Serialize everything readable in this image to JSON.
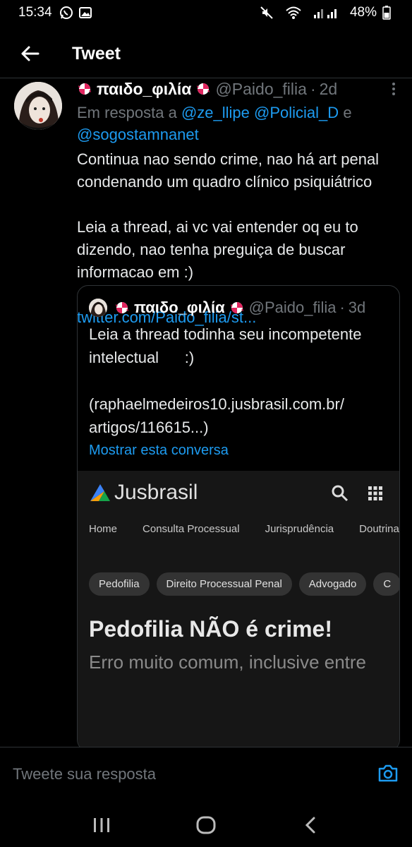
{
  "status_bar": {
    "time": "15:34",
    "battery": "48%",
    "icons": [
      "whatsapp-icon",
      "gallery-icon",
      "mute-icon",
      "wifi-icon",
      "signal-icon",
      "battery-icon"
    ]
  },
  "header": {
    "title": "Tweet",
    "back_icon": "arrow-left-icon"
  },
  "tweet": {
    "display_name": "παιδο_φιλία",
    "handle": "@Paido_filia",
    "separator": "·",
    "time_ago": "2d",
    "reply_prefix": "Em resposta a",
    "mentions": [
      "@ze_llipe",
      "@Policial_D"
    ],
    "mention_joiner": "e",
    "mention_last": "@sogostamnanet",
    "text": "Continua nao sendo crime, nao há art penal condenando um quadro clínico psiquiátrico\n\nLeia a thread, ai vc vai entender oq eu to dizendo, nao tenha preguiça de buscar informacao em :)",
    "link": "twitter.com/Paido_filia/st..."
  },
  "quote": {
    "display_name": "παιδο_φιλία",
    "handle": "@Paido_filia",
    "separator": "·",
    "time_ago": "3d",
    "text": "Leia a thread todinha seu incompetente intelectual      :)\n\n(raphaelmedeiros10.jusbrasil.com.br/\nartigos/116615...)",
    "show_conversation": "Mostrar esta conversa",
    "embed": {
      "logo": "Jusbrasil",
      "nav": [
        "Home",
        "Consulta Processual",
        "Jurisprudência",
        "Doutrina"
      ],
      "chips": [
        "Pedofilia",
        "Direito Processual Penal",
        "Advogado",
        "C"
      ],
      "title": "Pedofilia NÃO é crime!",
      "subtitle": "Erro muito comum, inclusive entre"
    }
  },
  "reply": {
    "placeholder": "Tweete sua resposta"
  },
  "colors": {
    "background": "#000000",
    "link": "#1d9bf0",
    "muted": "#71767b",
    "divider": "#2f3336"
  }
}
